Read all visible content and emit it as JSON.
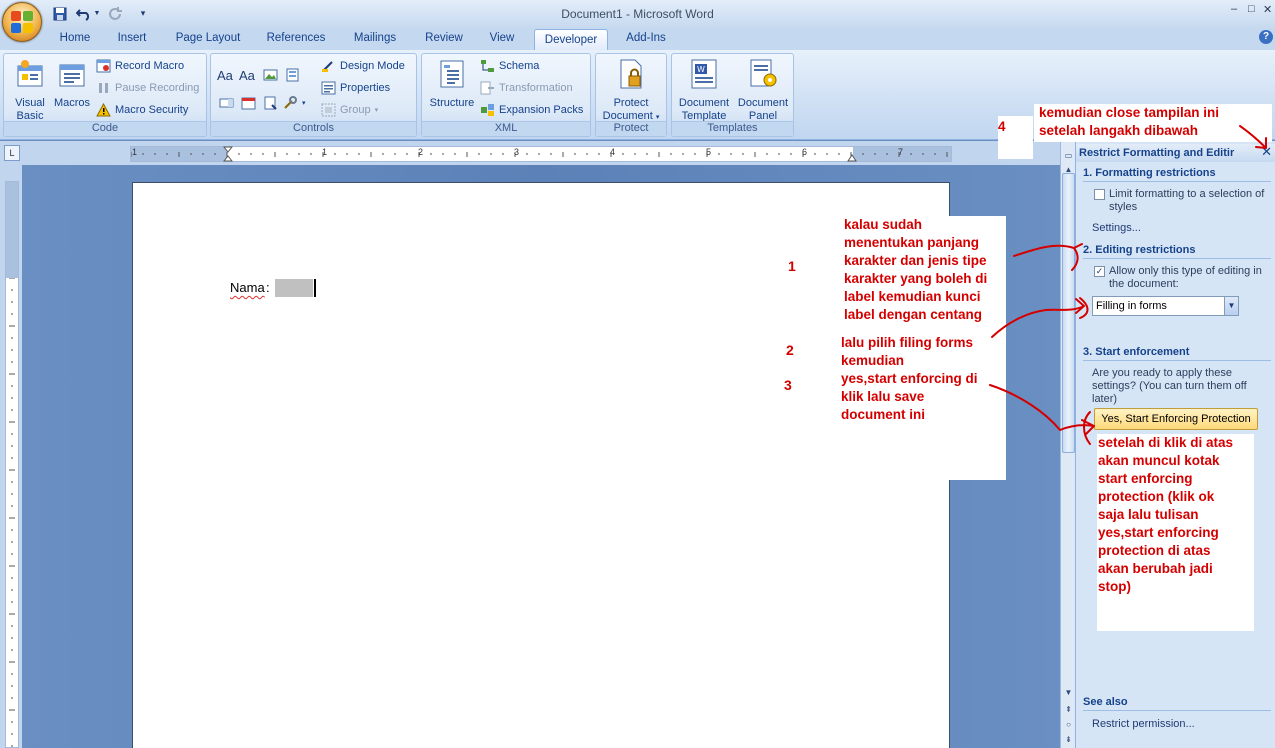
{
  "window": {
    "title": "Document1 - Microsoft Word",
    "controls": [
      "–",
      "□",
      "✕"
    ]
  },
  "quick_access": {
    "icons": [
      "save-icon",
      "undo-icon",
      "redo-icon",
      "customize-icon"
    ]
  },
  "tabs": [
    {
      "label": "Home"
    },
    {
      "label": "Insert"
    },
    {
      "label": "Page Layout"
    },
    {
      "label": "References"
    },
    {
      "label": "Mailings"
    },
    {
      "label": "Review"
    },
    {
      "label": "View"
    },
    {
      "label": "Developer"
    },
    {
      "label": "Add-Ins"
    }
  ],
  "active_tab": "Developer",
  "ribbon": {
    "code": {
      "label": "Code",
      "visual_basic": [
        "Visual",
        "Basic"
      ],
      "macros": "Macros",
      "record_macro": "Record Macro",
      "pause_recording": "Pause Recording",
      "macro_security": "Macro Security"
    },
    "controls": {
      "label": "Controls",
      "design_mode": "Design Mode",
      "properties": "Properties",
      "group": "Group"
    },
    "xml": {
      "label": "XML",
      "structure": "Structure",
      "schema": "Schema",
      "transformation": "Transformation",
      "expansion_packs": "Expansion Packs"
    },
    "protect": {
      "label": "Protect",
      "protect_document": [
        "Protect",
        "Document"
      ]
    },
    "templates": {
      "label": "Templates",
      "document_template": [
        "Document",
        "Template"
      ],
      "document_panel": [
        "Document",
        "Panel"
      ]
    }
  },
  "ruler": {
    "numbers": [
      "1",
      "1",
      "2",
      "3",
      "4",
      "5",
      "6",
      "7"
    ]
  },
  "document": {
    "label": "Nama",
    "colon": ":"
  },
  "task_pane": {
    "title": "Restrict Formatting and Editir",
    "section1": {
      "heading": "1. Formatting restrictions",
      "checkbox_label": [
        "Limit formatting to a selection of",
        "styles"
      ],
      "checked": false,
      "settings_link": "Settings..."
    },
    "section2": {
      "heading": "2. Editing restrictions",
      "checkbox_label": [
        "Allow only this type of editing in",
        "the document:"
      ],
      "checked": true,
      "select_value": "Filling in forms"
    },
    "section3": {
      "heading": "3. Start enforcement",
      "text": [
        "Are you ready to apply these",
        "settings? (You can turn them off",
        "later)"
      ],
      "button": "Yes, Start Enforcing Protection"
    },
    "see_also": {
      "heading": "See also",
      "link": "Restrict permission..."
    }
  },
  "annotations": {
    "top_note": [
      "kemudian close tampilan ini",
      "setelah langakh dibawah"
    ],
    "num4": "4",
    "note1": [
      "kalau sudah",
      "menentukan panjang",
      "karakter dan jenis tipe",
      "karakter yang boleh di",
      "label kemudian kunci",
      "label dengan centang"
    ],
    "num1": "1",
    "note2": [
      "lalu pilih filing forms",
      "kemudian",
      "yes,start enforcing di",
      "klik lalu save",
      "document ini"
    ],
    "num2": "2",
    "num3": "3",
    "note3": [
      "setelah di klik di atas",
      "akan muncul kotak",
      "start enforcing",
      "protection (klik ok",
      "saja lalu tulisan",
      "yes,start enforcing",
      "protection di atas",
      "akan berubah jadi",
      "stop)"
    ],
    "color": "#d40000"
  },
  "colors": {
    "ribbon_text": "#15428b",
    "doc_background": "#6b8fbf",
    "enforce_button": "#ffd97a"
  }
}
